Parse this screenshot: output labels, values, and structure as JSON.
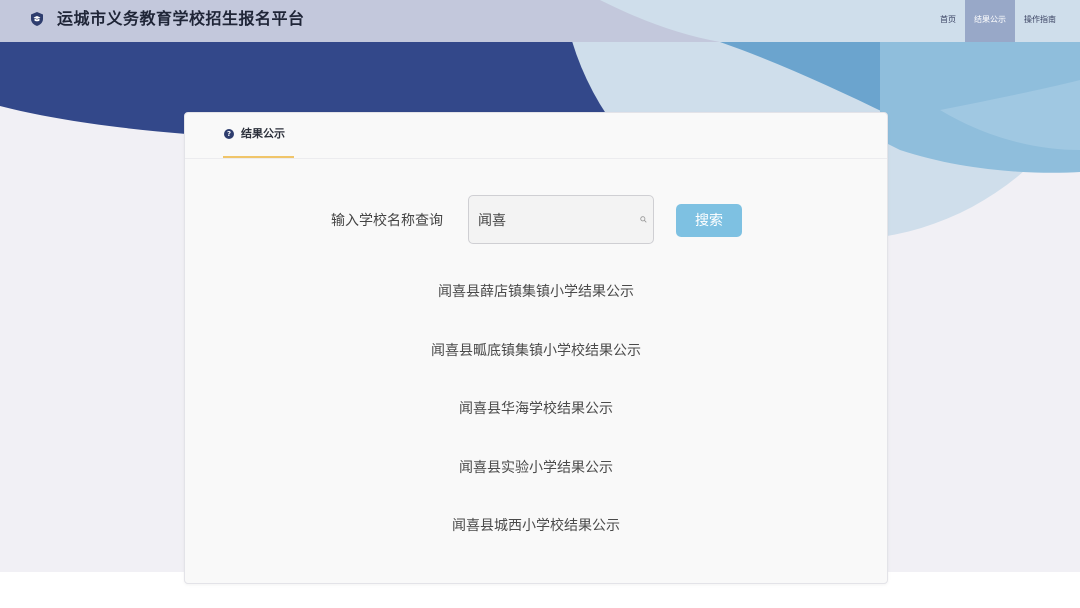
{
  "header": {
    "title": "运城市义务教育学校招生报名平台",
    "logo_icon": "school-shield-icon",
    "nav": [
      {
        "label": "首页",
        "active": false
      },
      {
        "label": "结果公示",
        "active": true
      },
      {
        "label": "操作指南",
        "active": false
      }
    ]
  },
  "card": {
    "tab": {
      "label": "结果公示",
      "icon": "question-circle-icon"
    },
    "search": {
      "label": "输入学校名称查询",
      "value": "闻喜",
      "placeholder": "",
      "button_label": "搜索",
      "icon": "search-icon"
    },
    "results": [
      {
        "label": "闻喜县薛店镇集镇小学结果公示"
      },
      {
        "label": "闻喜县畖底镇集镇小学校结果公示"
      },
      {
        "label": "闻喜县华海学校结果公示"
      },
      {
        "label": "闻喜县实验小学结果公示"
      },
      {
        "label": "闻喜县城西小学校结果公示"
      }
    ]
  },
  "colors": {
    "header_light": "#c3c8dc",
    "banner_navy": "#33488a",
    "accent_blue": "#5e9dc8",
    "page_bg": "#f1f0f5",
    "button": "#7ec1e2",
    "tab_underline": "#f0c56a",
    "nav_active": "#98a8c8"
  }
}
